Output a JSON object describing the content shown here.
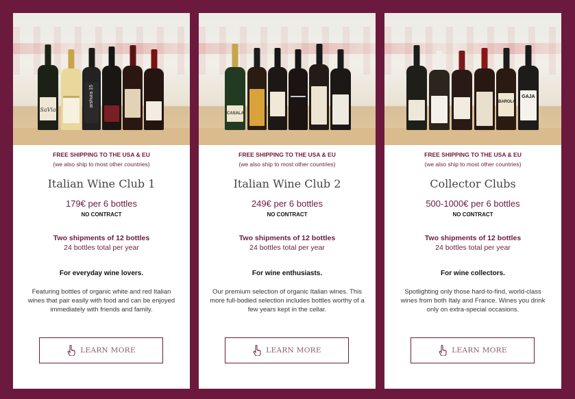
{
  "colors": {
    "background": "#6b1a3e",
    "accent": "#6b1a3e",
    "card": "#ffffff"
  },
  "cards": [
    {
      "shipping_line1": "FREE SHIPPING TO THE USA & EU",
      "shipping_line2": "(we also ship to most other countries)",
      "title": "Italian Wine Club 1",
      "price": "179€ per 6 bottles",
      "contract": "NO CONTRACT",
      "shipments": "Two shipments of 12 bottles",
      "total": "24 bottles total per year",
      "audience": "For everyday wine lovers.",
      "description": "Featuring bottles of organic white and red Italian wines that pair easily with food and can be enjoyed immediately with friends and family.",
      "button": "LEARN MORE",
      "button_icon": "pointer-hand-icon",
      "bottle_labels": [
        "SaVia",
        "",
        "arshura 15",
        "",
        "",
        ""
      ]
    },
    {
      "shipping_line1": "FREE SHIPPING TO THE USA & EU",
      "shipping_line2": "(we also ship to most other countries)",
      "title": "Italian Wine Club 2",
      "price": "249€ per 6 bottles",
      "contract": "NO CONTRACT",
      "shipments": "Two shipments of 12 bottles",
      "total": "24 bottles total per year",
      "audience": "For wine enthusiasts.",
      "description": "Our premium selection of organic Italian wines. This more full-bodied selection includes  bottles worthy of a few years kept in the cellar.",
      "button": "LEARN MORE",
      "button_icon": "pointer-hand-icon",
      "bottle_labels": [
        "CASALA",
        "",
        "",
        "",
        "",
        ""
      ]
    },
    {
      "shipping_line1": "FREE SHIPPING TO THE USA & EU",
      "shipping_line2": "(we also ship to most other countries)",
      "title": "Collector Clubs",
      "price": "500-1000€ per 6 bottles",
      "contract": "NO CONTRACT",
      "shipments": "Two shipments of 12 bottles",
      "total": "24 bottles total per year",
      "audience": "For wine collectors.",
      "description": "Spotlighting only those hard-to-find, world-class wines from both Italy and France. Wines you drink only on extra-special occasions.",
      "button": "LEARN MORE",
      "button_icon": "pointer-hand-icon",
      "bottle_labels": [
        "",
        "",
        "",
        "",
        "BAROLO",
        "GAJA"
      ]
    }
  ]
}
